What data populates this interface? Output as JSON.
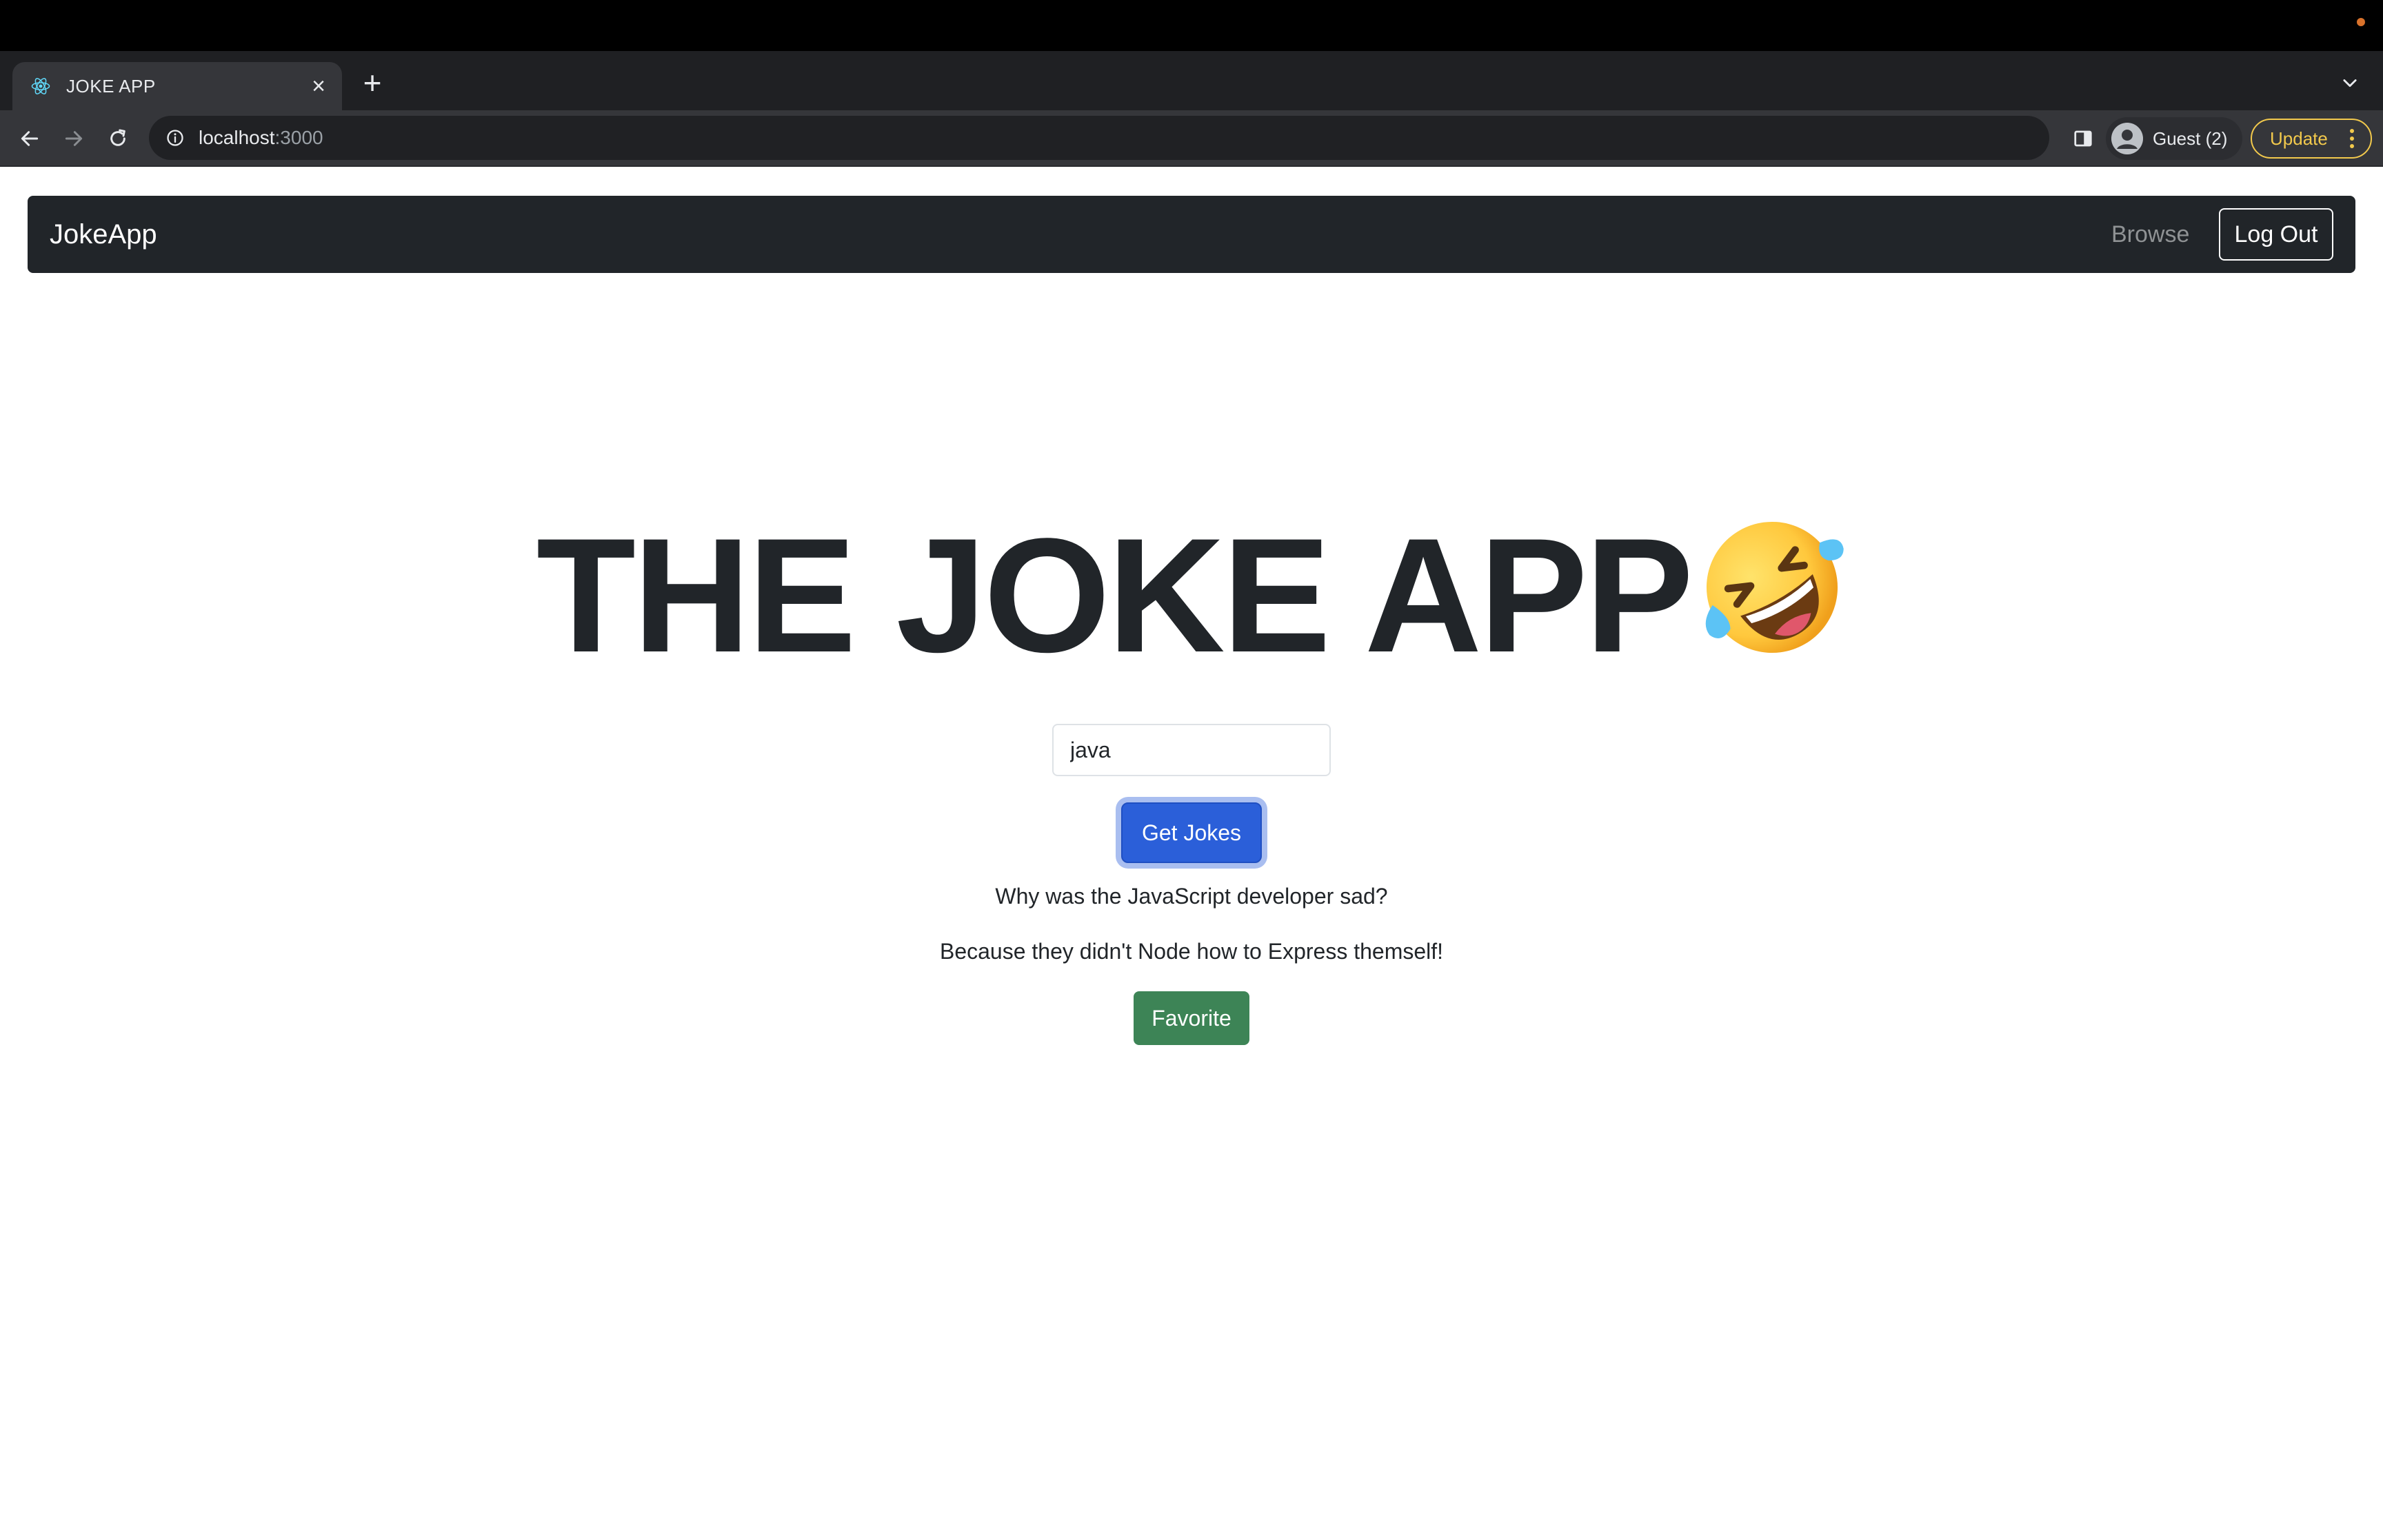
{
  "browser": {
    "tab": {
      "title": "JOKE APP",
      "close_symbol": "×"
    },
    "new_tab_symbol": "+",
    "address": {
      "host": "localhost",
      "port": ":3000"
    },
    "profile_label": "Guest (2)",
    "update_label": "Update"
  },
  "navbar": {
    "brand": "JokeApp",
    "browse_label": "Browse",
    "logout_label": "Log Out"
  },
  "hero": {
    "title": "THE JOKE APP",
    "emoji_icon": "rolling-on-floor-laughing-emoji"
  },
  "search": {
    "value": "java"
  },
  "get_jokes_label": "Get Jokes",
  "joke": {
    "setup": "Why was the JavaScript developer sad?",
    "punchline": "Because they didn't Node how to Express themself!"
  },
  "favorite_label": "Favorite",
  "colors": {
    "navbar_bg": "#212529",
    "primary_button": "#2b5fd9",
    "success_button": "#3d8456",
    "update_accent": "#f2c94c"
  }
}
